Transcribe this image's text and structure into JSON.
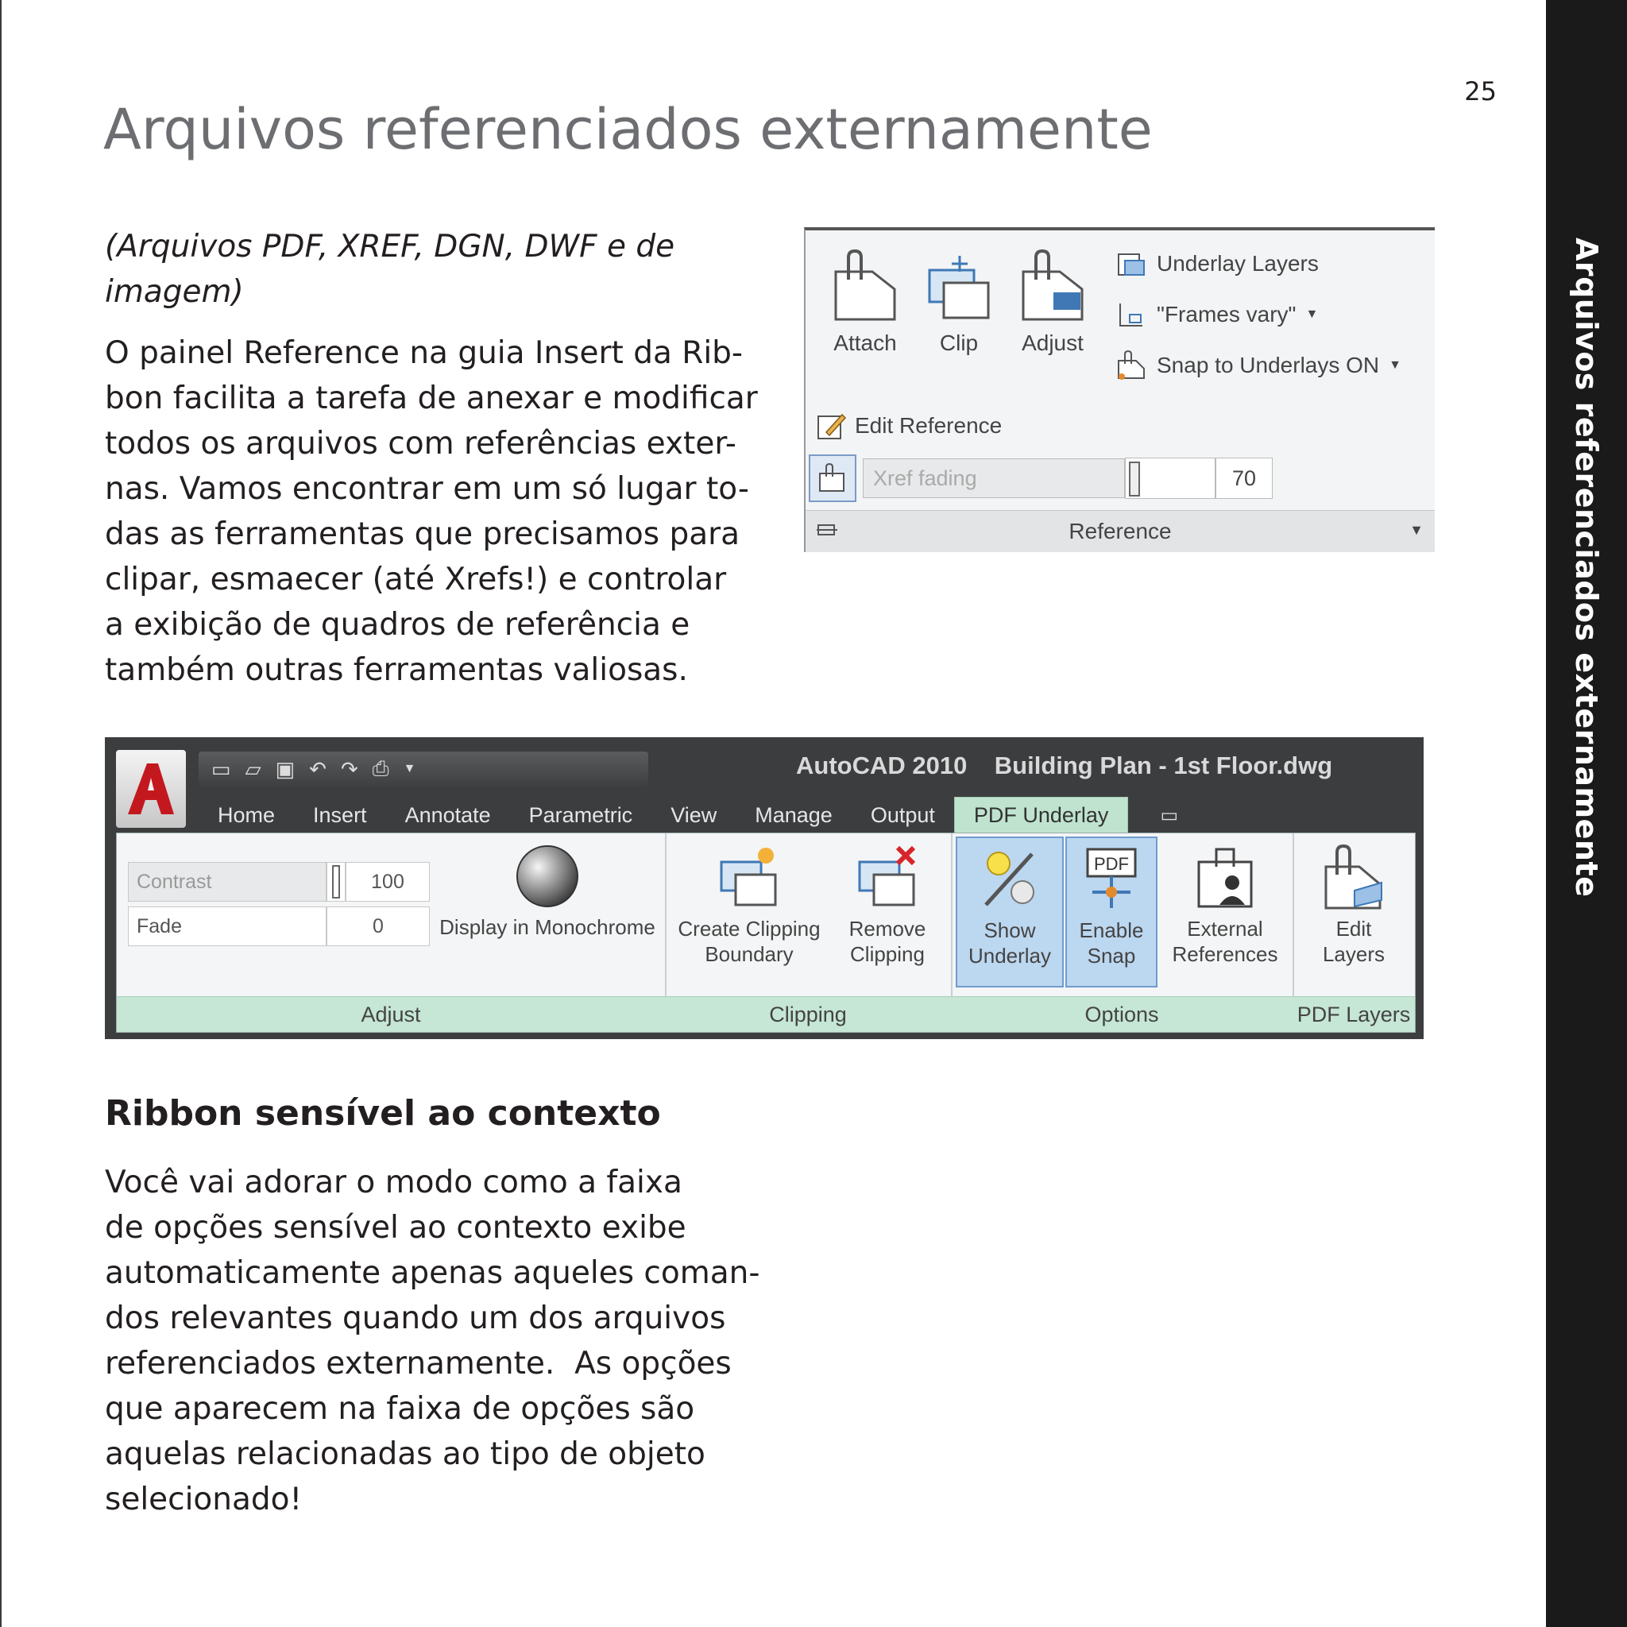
{
  "page": {
    "number": "25",
    "title": "Arquivos referenciados externamente",
    "side_tab": "Arquivos referenciados externamente",
    "subtitle_lines": [
      "(Arquivos PDF, XREF, DGN, DWF e de",
      "imagem)"
    ],
    "paragraph1_lines": [
      "O painel Reference na guia Insert da Rib-",
      "bon facilita a tarefa de anexar e modificar",
      "todos os arquivos com referências exter-",
      "nas. Vamos encontrar em um só lugar to-",
      "das as ferramentas que precisamos para",
      "clipar, esmaecer (até Xrefs!) e controlar",
      "a exibição de quadros de referência e",
      "também outras ferramentas valiosas."
    ],
    "section_heading": "Ribbon sensível ao contexto",
    "paragraph2_lines": [
      "Você vai adorar o modo como a faixa",
      "de opções sensível ao contexto exibe",
      "automaticamente apenas aqueles coman-",
      "dos relevantes quando um dos arquivos",
      "referenciados externamente.  As opções",
      "que aparecem na faixa de opções são",
      "aquelas relacionadas ao tipo de objeto",
      "selecionado!"
    ]
  },
  "reference_panel": {
    "attach": "Attach",
    "clip": "Clip",
    "adjust": "Adjust",
    "underlay_layers": "Underlay Layers",
    "frames": "\"Frames vary\"",
    "snap": "Snap to Underlays ON",
    "edit_reference": "Edit Reference",
    "xref_fading_label": "Xref fading",
    "xref_fading_value": "70",
    "footer": "Reference"
  },
  "autocad": {
    "title": "AutoCAD 2010    Building Plan - 1st Floor.dwg",
    "tabs": [
      "Home",
      "Insert",
      "Annotate",
      "Parametric",
      "View",
      "Manage",
      "Output",
      "PDF Underlay"
    ],
    "contrast_label": "Contrast",
    "contrast_value": "100",
    "fade_label": "Fade",
    "fade_value": "0",
    "monochrome": "Display in Monochrome",
    "create_clip": [
      "Create Clipping",
      "Boundary"
    ],
    "remove_clip": [
      "Remove",
      "Clipping"
    ],
    "show_underlay": [
      "Show",
      "Underlay"
    ],
    "enable_snap": [
      "Enable",
      "Snap"
    ],
    "external_refs": [
      "External",
      "References"
    ],
    "edit_layers": [
      "Edit",
      "Layers"
    ],
    "pdf_badge": "PDF",
    "panels": [
      "Adjust",
      "Clipping",
      "Options",
      "PDF Layers"
    ]
  },
  "colors": {
    "sidebar": "#1a1a1a",
    "title_gray": "#6d6e71",
    "ribbon_panel_label": "#c6e6d6",
    "active_tab": "#bfe3cf"
  }
}
